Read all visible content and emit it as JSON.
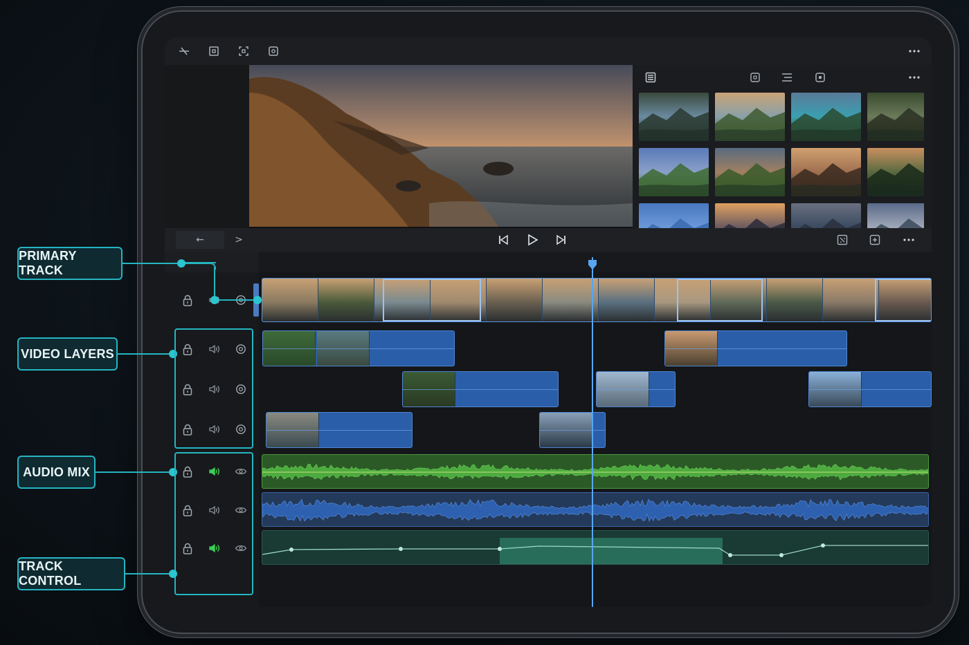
{
  "callouts": {
    "primary_track": "PRIMARY TRACK",
    "video_layers": "VIDEO LAYERS",
    "audio_mix": "AUDIO MIX",
    "track_control": "TRACK CONTROL"
  },
  "toolbar": {
    "top_icons": [
      "trim-icon",
      "crop-icon",
      "transform-icon",
      "stabilize-icon"
    ],
    "more_icon": "more-icon"
  },
  "browser": {
    "icons": [
      "list-icon",
      "clip-icon",
      "lines-icon",
      "square-icon",
      "more-icon"
    ],
    "thumbnails": [
      "river-canyon",
      "lake-sunset",
      "mountain-lake",
      "forest-path",
      "alpine-meadow",
      "valley-sunset",
      "coast-cliffs",
      "lake-trees",
      "sky-blue",
      "sunset-horizon",
      "mountains-dusk",
      "mountain-ridge"
    ]
  },
  "transport": {
    "back_label": "←",
    "forward_label": ">",
    "controls": [
      "skip-back-icon",
      "play-icon",
      "skip-forward-icon"
    ],
    "right_icons": [
      "fit-icon",
      "add-icon",
      "more-icon"
    ]
  },
  "colors": {
    "accent": "#24b6c2",
    "clip_blue": "#2a5ea8",
    "audio_green": "#3e8a3a",
    "audio_blue": "#2e5ea6",
    "playhead": "#5aa6f0"
  },
  "tracks": {
    "primary": {
      "controls": [
        "lock-icon",
        "speaker-icon",
        "target-icon"
      ]
    },
    "video_layers": [
      {
        "controls": [
          "lock-icon",
          "speaker-icon",
          "target-icon"
        ]
      },
      {
        "controls": [
          "lock-icon",
          "speaker-icon",
          "target-icon"
        ]
      },
      {
        "controls": [
          "lock-icon",
          "speaker-icon",
          "target-icon"
        ]
      }
    ],
    "audio": [
      {
        "controls": [
          "lock-icon",
          "speaker-active-icon",
          "eye-icon"
        ]
      },
      {
        "controls": [
          "lock-icon",
          "speaker-icon",
          "eye-icon"
        ]
      },
      {
        "controls": [
          "lock-icon",
          "speaker-active-icon",
          "eye-icon"
        ]
      }
    ]
  }
}
